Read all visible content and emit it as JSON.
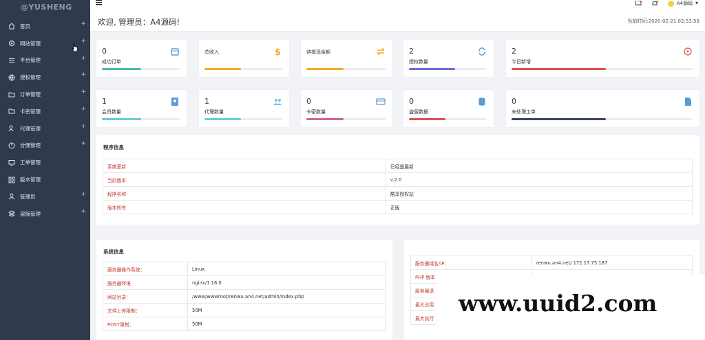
{
  "app": {
    "logo": "@YUSHENG"
  },
  "sidebar": {
    "items": [
      {
        "label": "首页",
        "icon": "home-icon",
        "plus": "+"
      },
      {
        "label": "网站管理",
        "icon": "gear-icon",
        "plus": "+"
      },
      {
        "label": "平台管理",
        "icon": "list-icon",
        "plus": "+"
      },
      {
        "label": "授权管理",
        "icon": "globe-icon",
        "plus": "+"
      },
      {
        "label": "订单管理",
        "icon": "folder-icon",
        "plus": "+"
      },
      {
        "label": "卡密管理",
        "icon": "folder-icon",
        "plus": "+"
      },
      {
        "label": "代理管理",
        "icon": "users-icon",
        "plus": "+"
      },
      {
        "label": "分佣管理",
        "icon": "pie-icon",
        "plus": "+"
      },
      {
        "label": "工单管理",
        "icon": "monitor-icon",
        "plus": ""
      },
      {
        "label": "版本管理",
        "icon": "grid-icon",
        "plus": ""
      },
      {
        "label": "管理员",
        "icon": "user-icon",
        "plus": "+"
      },
      {
        "label": "盗版管理",
        "icon": "layers-icon",
        "plus": "+"
      }
    ]
  },
  "topbar": {
    "menu_icon": "hamburger-icon",
    "user": "A4源码"
  },
  "header": {
    "welcome": "欢迎, 管理员：A4源码!",
    "time": "当前时间:2020-02-21 02:53:58"
  },
  "stats": [
    {
      "num": "0",
      "label": "成功订单",
      "icon": "calendar-icon",
      "color": "#4bbbb0",
      "fill": 0.5
    },
    {
      "num": "",
      "label": "总收入",
      "icon": "dollar-icon",
      "color": "#f0ad24",
      "fill": 0.47
    },
    {
      "num": "",
      "label": "待提现金额",
      "icon": "exchange-icon",
      "color": "#f0ad24",
      "fill": 0.47
    },
    {
      "num": "2",
      "label": "授权数量",
      "icon": "refresh-icon",
      "color": "#6d6fd6",
      "fill": 0.59
    },
    {
      "num": "2",
      "label": "今日新增",
      "icon": "target-icon",
      "color": "#d9534f",
      "fill": 0.52
    },
    {
      "num": "1",
      "label": "会员数量",
      "icon": "contact-icon",
      "color": "#6ec6e0",
      "fill": 0.5
    },
    {
      "num": "1",
      "label": "代理数量",
      "icon": "group-icon",
      "color": "#6ec6e0",
      "fill": 0.47
    },
    {
      "num": "0",
      "label": "卡密数量",
      "icon": "card-icon",
      "color": "#c86598",
      "fill": 0.47
    },
    {
      "num": "0",
      "label": "盗版数据",
      "icon": "database-icon",
      "color": "#d9534f",
      "fill": 0.47
    },
    {
      "num": "0",
      "label": "未处理工单",
      "icon": "file-icon",
      "color": "#3c4565",
      "fill": 0.52
    }
  ],
  "program_info": {
    "title": "程序信息",
    "rows": [
      {
        "k": "系统更新",
        "v": "已经是最新"
      },
      {
        "k": "当前版本",
        "v": "v.2.0"
      },
      {
        "k": "程序名称",
        "v": "酷享授权站"
      },
      {
        "k": "版本所有",
        "v": "正版"
      }
    ]
  },
  "system_info": {
    "title": "系统信息",
    "rows": [
      {
        "k": "服务器操作系统：",
        "v": "Linux"
      },
      {
        "k": "服务器环境",
        "v": "nginx/1.16.0"
      },
      {
        "k": "网站目录：",
        "v": "/www/wwwroot/renwu.an4.net/admin/index.php"
      },
      {
        "k": "文件上传限制：",
        "v": "50M"
      },
      {
        "k": "POST限制：",
        "v": "50M"
      }
    ]
  },
  "server_info": {
    "rows": [
      {
        "k": "服务器域名/IP：",
        "v": "renwu.an4.net/ 172.17.75.187"
      },
      {
        "k": "PHP 版本",
        "v": ""
      },
      {
        "k": "服务器语",
        "v": ""
      },
      {
        "k": "最大占用",
        "v": ""
      },
      {
        "k": "最大执行",
        "v": ""
      }
    ]
  },
  "watermark": "www.uuid2.com"
}
